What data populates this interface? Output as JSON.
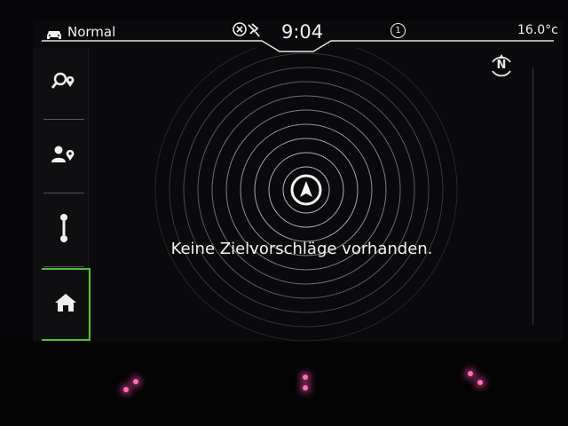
{
  "status_bar": {
    "drive_mode": "Normal",
    "time": "9:04",
    "notification_count": "1",
    "temperature": "16.0°c"
  },
  "map": {
    "compass_label": "N",
    "message": "Keine Zielvorschläge vorhanden."
  },
  "sidebar": {
    "items": [
      {
        "icon": "destination-search-icon"
      },
      {
        "icon": "contact-destination-icon"
      },
      {
        "icon": "route-icon"
      },
      {
        "icon": "home-icon",
        "active": true
      }
    ]
  },
  "colors": {
    "active_highlight": "#4fc534",
    "ambient_led": "#ff6fb8"
  }
}
